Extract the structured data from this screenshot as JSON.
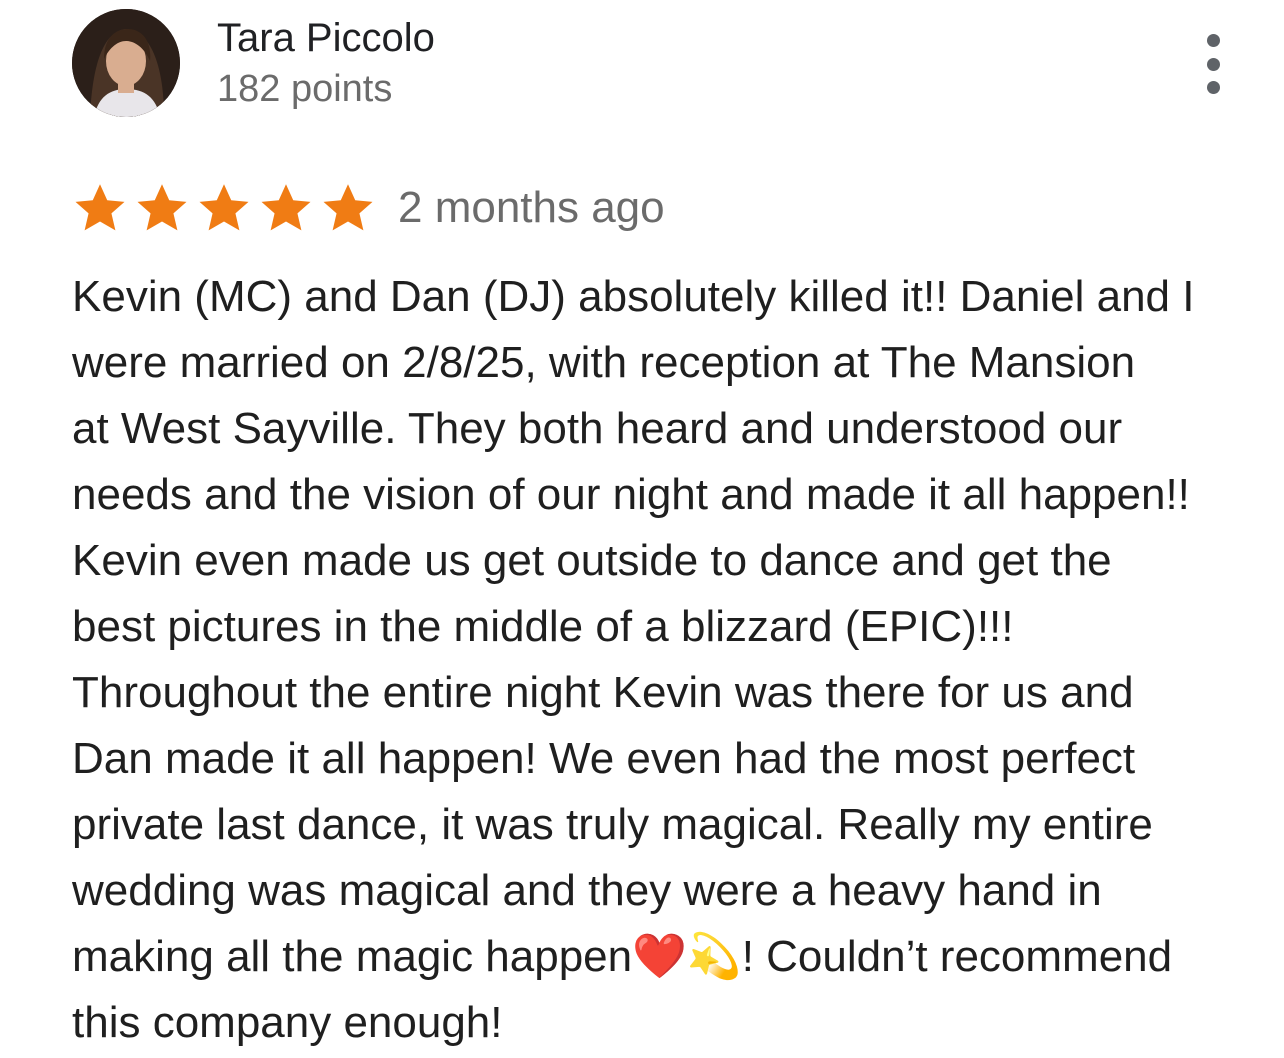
{
  "review": {
    "reviewer_name": "Tara Piccolo",
    "reviewer_points": "182 points",
    "rating": 5,
    "rating_max": 5,
    "date": "2 months ago",
    "text": "Kevin (MC) and Dan (DJ) absolutely killed it!! Daniel and I\nwere married on 2/8/25, with reception at The Mansion\nat West Sayville. They both heard and understood our\nneeds and the vision of our night and made it all happen!!\nKevin even made us get outside to dance and get the\nbest pictures in the middle of a blizzard (EPIC)!!!\nThroughout the entire night Kevin was there for us and\nDan made it all happen! We even had the most perfect\nprivate last dance, it was truly magical. Really my entire\nwedding was magical and they were a heavy hand in\nmaking all the magic happen❤️💫! Couldn’t recommend\nthis company enough!"
  },
  "icons": {
    "more": "more-vert-icon",
    "star": "star-icon"
  },
  "colors": {
    "star": "#f07c14",
    "muted_text": "#6b6b6b",
    "body_text": "#1f1f1f"
  }
}
